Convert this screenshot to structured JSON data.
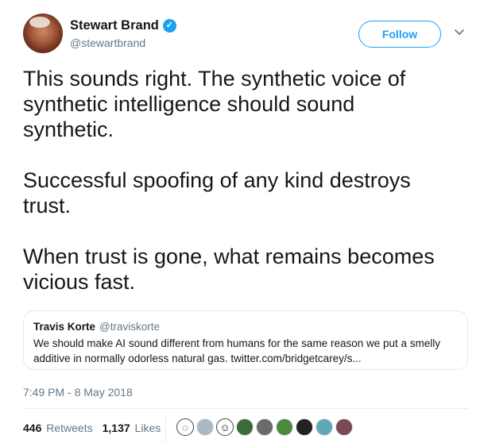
{
  "author": {
    "display_name": "Stewart Brand",
    "handle": "@stewartbrand",
    "verified_icon": "verified-badge-icon"
  },
  "header": {
    "follow_label": "Follow",
    "menu_icon": "chevron-down-icon"
  },
  "tweet": {
    "text": "This sounds right.  The synthetic voice of\nsynthetic intelligence should sound\nsynthetic.\n\nSuccessful spoofing of any kind destroys\ntrust.\n\nWhen trust is gone, what remains becomes\nvicious fast.",
    "timestamp": "7:49 PM - 8 May 2018"
  },
  "quoted_tweet": {
    "display_name": "Travis Korte",
    "handle": "@traviskorte",
    "text": "We should make AI sound different from humans for the same reason we put a smelly additive in normally odorless natural gas. twitter.com/bridgetcarey/s..."
  },
  "stats": {
    "retweets_count": "446",
    "retweets_label": "Retweets",
    "likes_count": "1,137",
    "likes_label": "Likes"
  },
  "likers": [
    {
      "icon": "outline-face-icon",
      "glyph": "◌"
    },
    {
      "icon": "default-avatar-icon",
      "color": "#aab8c2"
    },
    {
      "icon": "outline-smile-icon",
      "glyph": "☺"
    },
    {
      "icon": "avatar-icon",
      "color": "#3a6b3a"
    },
    {
      "icon": "avatar-icon",
      "color": "#6b6b6b"
    },
    {
      "icon": "avatar-icon",
      "color": "#4b8a3c"
    },
    {
      "icon": "avatar-icon",
      "color": "#222222"
    },
    {
      "icon": "avatar-icon",
      "color": "#5fa8b5"
    },
    {
      "icon": "avatar-icon",
      "color": "#7a4a55"
    }
  ],
  "colors": {
    "accent": "#1da1f2",
    "text_primary": "#14171a",
    "text_secondary": "#657786",
    "border": "#e1e8ed"
  }
}
